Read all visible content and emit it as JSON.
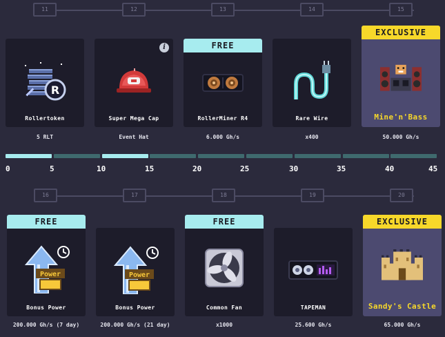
{
  "row1": {
    "levels": [
      "11",
      "12",
      "13",
      "14",
      "15"
    ],
    "cards": [
      {
        "name": "Rollertoken",
        "value": "5 RLT",
        "banner": "",
        "icon": "rlt-coins-icon"
      },
      {
        "name": "Super Mega Cap",
        "value": "Event Hat",
        "banner": "",
        "icon": "red-cap-icon",
        "info": "i"
      },
      {
        "name": "RollerMiner R4",
        "value": "6.000 Gh/s",
        "banner": "FREE",
        "icon": "miner-icon"
      },
      {
        "name": "Rare Wire",
        "value": "x400",
        "banner": "",
        "icon": "wire-icon"
      },
      {
        "name": "Mine'n'Bass",
        "value": "50.000 Gh/s",
        "banner": "EXCLUSIVE",
        "icon": "dj-hamster-icon"
      }
    ]
  },
  "progress": {
    "ticks": [
      "0",
      "5",
      "10",
      "15",
      "20",
      "25",
      "30",
      "35",
      "40",
      "45"
    ],
    "completed_segments": [
      true,
      false,
      true,
      false,
      false,
      false,
      false,
      false,
      false
    ]
  },
  "row2": {
    "levels": [
      "16",
      "17",
      "18",
      "19",
      "20"
    ],
    "cards": [
      {
        "name": "Bonus Power",
        "value": "200.000 Gh/s (7 day)",
        "banner": "FREE",
        "icon": "bonus-power-icon"
      },
      {
        "name": "Bonus Power",
        "value": "200.000 Gh/s (21 day)",
        "banner": "",
        "icon": "bonus-power-icon"
      },
      {
        "name": "Common Fan",
        "value": "x1000",
        "banner": "FREE",
        "icon": "fan-icon"
      },
      {
        "name": "TAPEMAN",
        "value": "25.600 Gh/s",
        "banner": "",
        "icon": "tapeman-icon"
      },
      {
        "name": "Sandy's Castle",
        "value": "65.000 Gh/s",
        "banner": "EXCLUSIVE",
        "icon": "sand-castle-icon"
      }
    ]
  },
  "colors": {
    "free": "#a7ecef",
    "exclusive": "#f7d82a",
    "background": "#2b2a3c",
    "card": "#1d1c2a",
    "exclusive_card": "#4c4a70"
  }
}
